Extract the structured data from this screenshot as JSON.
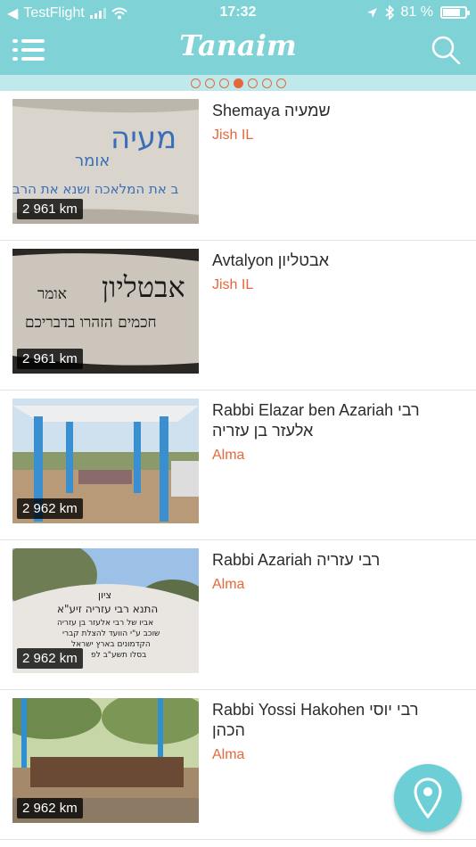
{
  "status_bar": {
    "carrier": "TestFlight",
    "time": "17:32",
    "battery_text": "81 %",
    "battery_level": 0.81
  },
  "header": {
    "title": "Tanaim",
    "menu_icon": "hamburger-icon",
    "search_icon": "search-icon"
  },
  "pager": {
    "count": 7,
    "active_index": 3
  },
  "colors": {
    "accent": "#7fd3d7",
    "highlight": "#e8673a",
    "fab": "#6ccfd6"
  },
  "items": [
    {
      "name": "Shemaya שמעיה",
      "location": "Jish IL",
      "distance": "2 961 km"
    },
    {
      "name": "Avtalyon אבטליון",
      "location": "Jish IL",
      "distance": "2 961 km"
    },
    {
      "name": "Rabbi Elazar ben Azariah רבי אלעזר בן עזריה",
      "location": "Alma",
      "distance": "2 962 km"
    },
    {
      "name": "Rabbi Azariah רבי עזריה",
      "location": "Alma",
      "distance": "2 962 km"
    },
    {
      "name": "Rabbi Yossi Hakohen רבי יוסי הכהן",
      "location": "Alma",
      "distance": "2 962 km"
    }
  ],
  "fab": {
    "icon": "map-pin-icon"
  }
}
